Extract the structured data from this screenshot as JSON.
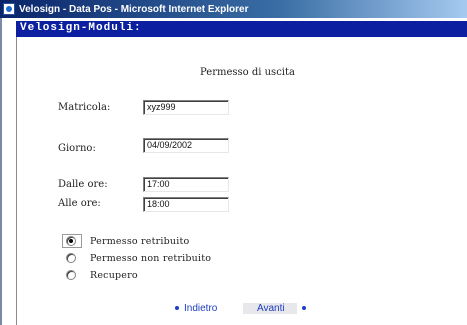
{
  "window": {
    "title": "Velosign - Data Pos - Microsoft Internet Explorer"
  },
  "banner": {
    "title": "Velosign-Moduli:"
  },
  "form": {
    "heading": "Permesso di uscita",
    "matricola_label": "Matricola:",
    "matricola_value": "xyz999",
    "giorno_label": "Giorno:",
    "giorno_value": "04/09/2002",
    "dalle_label": "Dalle ore:",
    "dalle_value": "17:00",
    "alle_label": "Alle ore:",
    "alle_value": "18:00",
    "options": [
      {
        "label": "Permesso retribuito",
        "checked": true
      },
      {
        "label": "Permesso non retribuito",
        "checked": false
      },
      {
        "label": "Recupero",
        "checked": false
      }
    ]
  },
  "navigation": {
    "back_label": "Indietro",
    "next_label": "Avanti"
  },
  "colors": {
    "banner": "#0b1fa0",
    "link": "#1e3fc0"
  }
}
